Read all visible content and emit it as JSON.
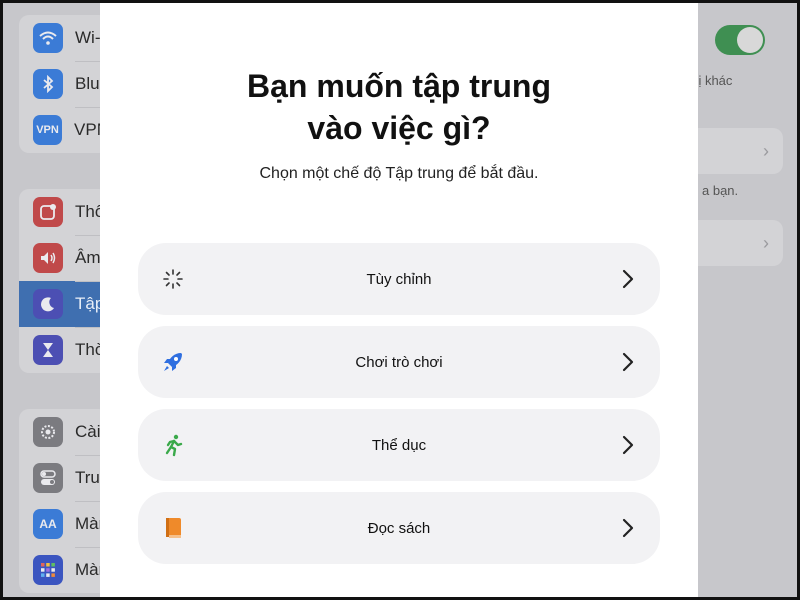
{
  "background": {
    "sidebar": {
      "group1": [
        {
          "label": "Wi-",
          "icon": "wifi-icon",
          "color": "#3b7bd6"
        },
        {
          "label": "Blu",
          "icon": "bluetooth-icon",
          "color": "#3b7bd6"
        },
        {
          "label": "VPN",
          "icon": "vpn-icon",
          "color": "#3b7bd6",
          "badge": "VPN"
        }
      ],
      "group2": [
        {
          "label": "Thô",
          "icon": "notification-icon",
          "color": "#c0494a"
        },
        {
          "label": "Âm",
          "icon": "speaker-icon",
          "color": "#c0494a"
        },
        {
          "label": "Tập",
          "icon": "moon-icon",
          "color": "#4c4fb3",
          "active": true
        },
        {
          "label": "Thờ",
          "icon": "hourglass-icon",
          "color": "#4c4fb3"
        }
      ],
      "group3": [
        {
          "label": "Cài",
          "icon": "gear-icon",
          "color": "#7b7b80"
        },
        {
          "label": "Tru",
          "icon": "switches-icon",
          "color": "#7b7b80"
        },
        {
          "label": "Màn",
          "icon": "text-size-icon",
          "color": "#3b7bd6",
          "badge": "AA"
        },
        {
          "label": "Màn",
          "icon": "home-grid-icon",
          "color": "#3b55c0"
        }
      ]
    },
    "right": {
      "text1": "t bị khác",
      "text2": "a bạn."
    }
  },
  "modal": {
    "title_line1": "Bạn muốn tập trung",
    "title_line2": "vào việc gì?",
    "subtitle": "Chọn một chế độ Tập trung để bắt đầu.",
    "options": [
      {
        "label": "Tùy chỉnh",
        "icon": "sparkle-icon",
        "color": "#333333"
      },
      {
        "label": "Chơi trò chơi",
        "icon": "rocket-icon",
        "color": "#2f6fe0"
      },
      {
        "label": "Thể dục",
        "icon": "running-figure-icon",
        "color": "#3aa94a"
      },
      {
        "label": "Đọc sách",
        "icon": "book-icon",
        "color": "#ef8a2a"
      }
    ]
  }
}
